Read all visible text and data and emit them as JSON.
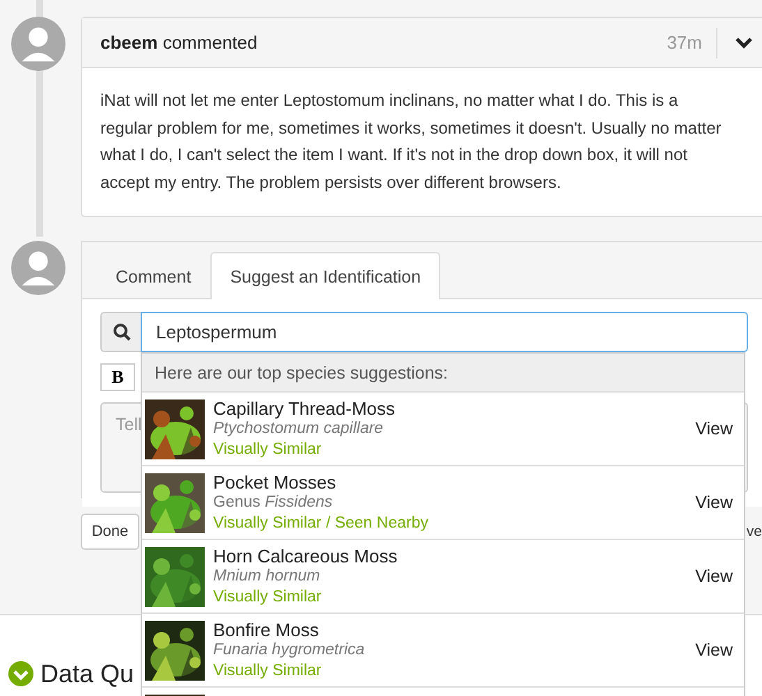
{
  "comment": {
    "user": "cbeem",
    "action": "commented",
    "time": "37m",
    "body": "iNat will not let me enter Leptostomum inclinans, no matter what I do. This is a regular problem for me, sometimes it works, sometimes it doesn't. Usually no matter what I do, I can't select the item I want. If it's not in the drop down box, it will not accept my entry. The problem persists over different browsers."
  },
  "tabs": [
    {
      "label": "Comment",
      "selected": false
    },
    {
      "label": "Suggest an Identification",
      "selected": true
    }
  ],
  "search": {
    "value": "Leptospermum"
  },
  "toolbar": {
    "bold": "B"
  },
  "textarea": {
    "placeholder": "Tell"
  },
  "done_button": "Done",
  "side_text": "ve",
  "section_title": "Data Qu",
  "suggestions": {
    "header": "Here are our top species suggestions:",
    "items": [
      {
        "name": "Capillary Thread-Moss",
        "scientific": "Ptychostomum capillare",
        "tag": "Visually Similar",
        "action": "View"
      },
      {
        "name": "Pocket Mosses",
        "rank": "Genus",
        "scientific": "Fissidens",
        "tag": "Visually Similar / Seen Nearby",
        "action": "View"
      },
      {
        "name": "Horn Calcareous Moss",
        "scientific": "Mnium hornum",
        "tag": "Visually Similar",
        "action": "View"
      },
      {
        "name": "Bonfire Moss",
        "scientific": "Funaria hygrometrica",
        "tag": "Visually Similar",
        "action": "View"
      }
    ]
  }
}
